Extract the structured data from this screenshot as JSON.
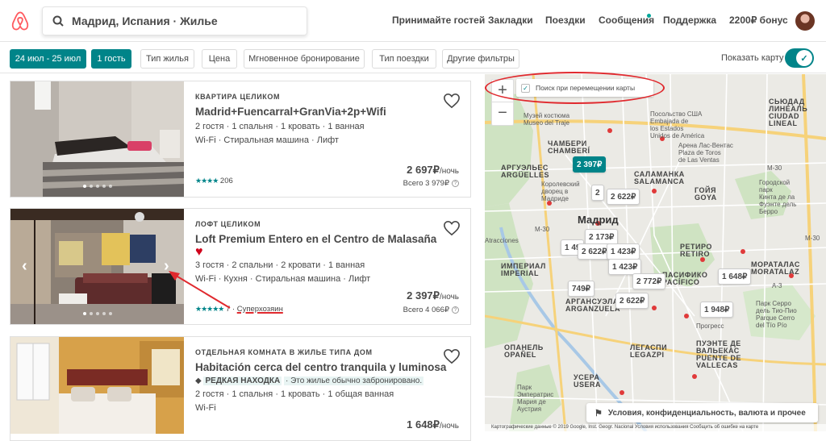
{
  "header": {
    "search_value": "Мадрид, Испания · Жилье",
    "nav": [
      "Принимайте гостей",
      "Закладки",
      "Поездки",
      "Сообщения",
      "Поддержка",
      "2200₽ бонус"
    ]
  },
  "filters": {
    "chips": [
      "24 июл - 25 июл",
      "1 гость",
      "Тип жилья",
      "Цена",
      "Мгновенное бронирование",
      "Тип поездки",
      "Другие фильтры"
    ],
    "show_map_label": "Показать карту"
  },
  "listings": [
    {
      "kind": "КВАРТИРА ЦЕЛИКОМ",
      "title": "Madrid+Fuencarral+GranVia+2p+Wifi",
      "details": "2 гостя · 1 спальня · 1 кровать · 1 ванная",
      "amenities": "Wi-Fi · Стиральная машина · Лифт",
      "stars": "★★★★",
      "reviews": "206",
      "price": "2 697₽",
      "per_night": "/ночь",
      "total": "Всего 3 979₽"
    },
    {
      "kind": "ЛОФТ ЦЕЛИКОМ",
      "title": "Loft Premium Entero en el Centro de Malasaña",
      "title_emoji": "♥",
      "details": "3 гостя · 2 спальни · 2 кровати · 1 ванная",
      "amenities": "Wi-Fi · Кухня · Стиральная машина · Лифт",
      "stars": "★★★★★",
      "reviews": "7",
      "superhost": "Суперхозяин",
      "price": "2 397₽",
      "per_night": "/ночь",
      "total": "Всего 4 066₽"
    },
    {
      "kind": "ОТДЕЛЬНАЯ КОМНАТА В ЖИЛЬЕ ТИПА ДОМ",
      "title": "Habitación cerca del centro tranquila y luminosa",
      "rare_badge": "РЕДКАЯ НАХОДКА",
      "rare_text": "· Это жилье обычно забронировано.",
      "details": "2 гостя · 1 спальня · 1 кровать · 1 общая ванная",
      "amenities": "Wi-Fi",
      "price": "1 648₽",
      "per_night": "/ночь"
    }
  ],
  "map": {
    "zoom_in": "+",
    "zoom_out": "−",
    "search_on_move": "Поиск при перемещении карты",
    "pins": [
      "2 397₽",
      "2 622₽",
      "2 173₽",
      "2 622₽",
      "1 423₽",
      "1 423₽",
      "2 772₽",
      "749₽",
      "2 622₽",
      "1 648₽",
      "1 948₽",
      "1 49",
      "2"
    ],
    "labels": {
      "chamberi": "ЧАМБЕРИ\nCHAMBERÍ",
      "madrid": "Мадрид",
      "salamanca": "САЛАМАНКА\nSALAMANCA",
      "retiro": "РЕТИРО\nRETIRO",
      "arganzuela": "АРГАНСУЭЛА\nARGANZUELA",
      "moratalaz": "МОРАТАЛАС\nMORATALAZ",
      "vallecas": "ПУЭНТЕ ДЕ\nВАЛЬЕКАС\nPUENTE DE\nVALLECAS",
      "usera": "УСЕРА\nUSERA",
      "lineal": "СЬЮДАД\nЛИНЕАЛЬ\nCIUDAD\nLINEAL",
      "pacifico": "ПАСИФИКО\nPACÍFICO",
      "museo_traje": "Музей костюма\nMuseo del Traje",
      "real_palace": "Королевский\nдворец в\nМадриде",
      "usa_embassy": "Посольство США\nEmbajada de\nlos Estados\nUnidos de América",
      "las_ventas": "Арена Лас-Вентас\nPlaza de Toros\nde Las Ventas",
      "quinta_fuente": "Городской\nпарк\nКинта де ла\nФуэнте дель\nБерро",
      "goya": "ГОЙЯ\nGOYA",
      "arguelles": "АРГУЭЛЬЕС\nARGÜELLES",
      "imperial": "ИМПЕРИАЛ\nIMPERIAL",
      "legazpi": "ЛЕГАСПИ\nLEGAZPI",
      "opanel": "ОПАНЕЛЬ\nOPAÑEL",
      "parque_sierra": "Парк Серро\nдель Тио-Пио\nParque Cerro\ndel Tío Pío",
      "parque_emperatriz": "Парк\nЭмператрис\nМария де\nАустрия",
      "vallecas_road": "Прогресс",
      "atracciones": "Atracciones",
      "m30_a": "M-30",
      "m30_b": "M-30",
      "m30_c": "M-30",
      "a3": "A-3"
    },
    "legal_text": "Условия, конфиденциальность, валюта и прочее",
    "copyright": "Картографические данные © 2019 Google, Inst. Geogr. Nacional   Условия использования   Сообщить об ошибке на карте"
  },
  "colors": {
    "accent": "#008489",
    "brand": "#FF5A5F",
    "annotation": "#E0292E"
  }
}
